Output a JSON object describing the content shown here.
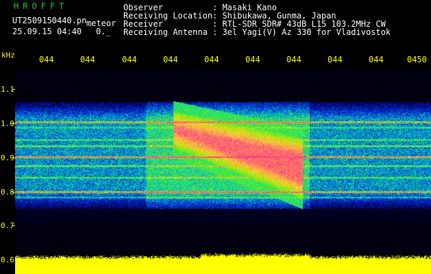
{
  "header": {
    "brand": "HROFFT",
    "filename": "UT2509150440.pn",
    "filename_suffix": "meteor",
    "timestamp": "25.09.15 04:40",
    "timestamp_extra": "0._",
    "fields": [
      {
        "label": "Observer",
        "value": ": Masaki Kano"
      },
      {
        "label": "Receiving Location",
        "value": ": Shibukawa, Gunma, Japan"
      },
      {
        "label": "Receiver",
        "value": ": RTL-SDR SDR# 43dB L15 103.2MHz CW"
      },
      {
        "label": "Receiving Antenna",
        "value": ": 3el Yagi(V) Az 330 for Vladivostok"
      }
    ]
  },
  "axes": {
    "y_unit": "kHz",
    "y_ticks": [
      "1.1",
      "1.0",
      "0.9",
      "0.8",
      "0.7",
      "0.6"
    ],
    "x_ticks": [
      "044",
      "044",
      "044",
      "044",
      "044",
      "044",
      "044",
      "044",
      "044",
      "0450"
    ]
  },
  "colors": {
    "background": "#000000",
    "tick_text": "#ffff00",
    "header_text": "#ffffff",
    "brand_text": "#1fd11f",
    "signal_peak": "#ff2a7a",
    "noise_floor": "#ffff00"
  }
}
